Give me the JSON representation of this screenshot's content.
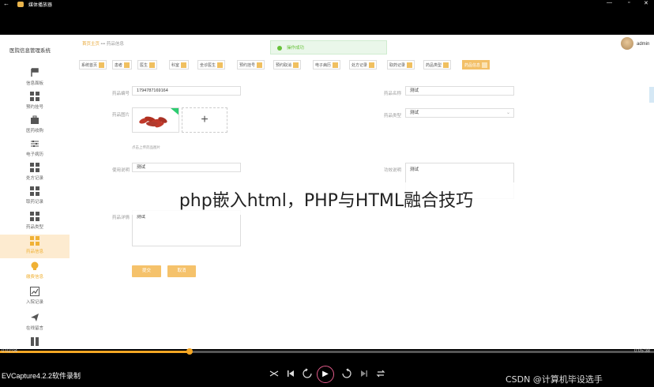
{
  "window": {
    "title": "媒体播放器",
    "back_glyph": "←",
    "min": "—",
    "max": "▫",
    "close": "✕"
  },
  "app": {
    "system_title": "医院信息管理系统",
    "user_name": "admin",
    "breadcrumb": {
      "home": "首页主页",
      "sep": "•••",
      "current": "药品信息"
    },
    "toast": "操作成功",
    "sidebar": [
      {
        "label": "信息面板",
        "icon": "flag-icon"
      },
      {
        "label": "预约挂号",
        "icon": "grid-icon"
      },
      {
        "label": "医药收购",
        "icon": "briefcase-icon"
      },
      {
        "label": "电子病历",
        "icon": "sliders-icon"
      },
      {
        "label": "处方记录",
        "icon": "grid-icon"
      },
      {
        "label": "取药记录",
        "icon": "grid-icon"
      },
      {
        "label": "药品类型",
        "icon": "grid-icon"
      },
      {
        "label": "药品信息",
        "icon": "grid-icon"
      },
      {
        "label": "缴费信息",
        "icon": "bulb-icon"
      },
      {
        "label": "入院记录",
        "icon": "chart-icon"
      },
      {
        "label": "在线留言",
        "icon": "send-icon"
      },
      {
        "label": "",
        "icon": "book-icon"
      }
    ],
    "tabs": [
      "系统首页",
      "患者",
      "医生",
      "科室",
      "坐诊医生",
      "预约挂号",
      "预约取消",
      "电子病历",
      "处方记录",
      "取药记录",
      "药品类型",
      "药品信息"
    ],
    "form": {
      "code_label": "药品编号",
      "code_value": "1794787169164",
      "name_label": "药品名称",
      "name_value": "测试",
      "image_label": "药品图片",
      "upload_glyph": "+",
      "upload_hint": "点击上传药品图片",
      "type_label": "药品类型",
      "type_value": "测试",
      "usage_label": "使用说明",
      "usage_value": "测试",
      "effect_label": "功效说明",
      "effect_value": "测试",
      "detail_label": "药品详情",
      "detail_value": "测试",
      "submit": "提交",
      "cancel": "取消"
    }
  },
  "overlay_caption": "php嵌入html，PHP与HTML融合技巧",
  "player": {
    "progress": 0.29,
    "time_current": "0:02:04",
    "time_total": "0:05:38",
    "recorder": "EVCapture4.2.2软件录制",
    "play_glyph": "▶"
  },
  "watermark": "CSDN @计算机毕设选手"
}
